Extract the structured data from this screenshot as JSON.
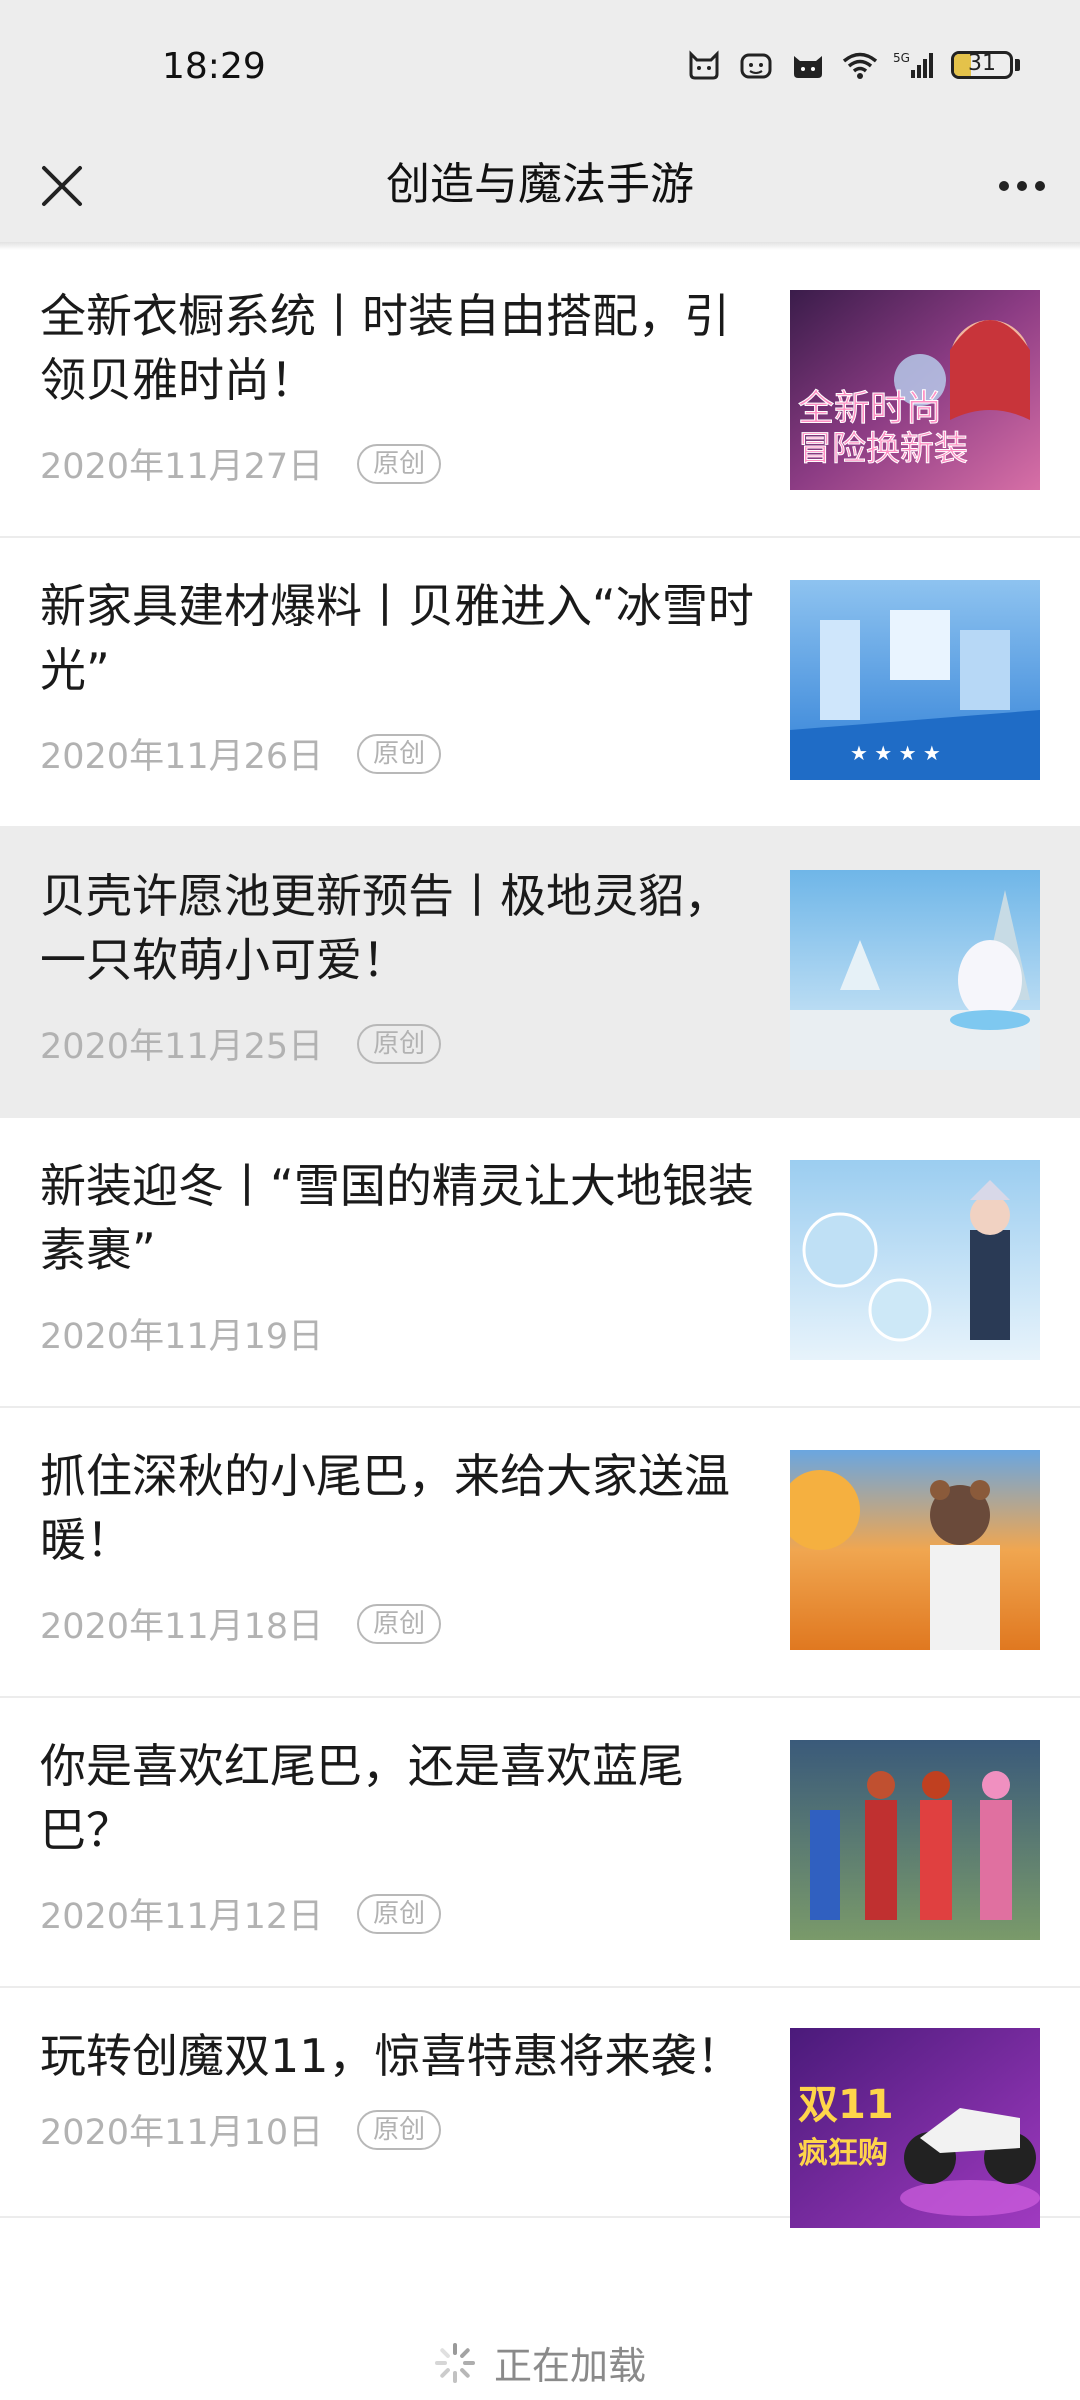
{
  "status_bar": {
    "time": "18:29",
    "battery": "31",
    "battery_level": 0.31,
    "icons": [
      "notification-cat-icon",
      "notification-face-icon",
      "notification-cat2-icon",
      "wifi-icon",
      "signal-5g-icon",
      "battery-icon"
    ]
  },
  "header": {
    "title": "创造与魔法手游",
    "close_icon": "close-icon",
    "more_icon": "more-icon"
  },
  "articles": [
    {
      "title": "全新衣橱系统丨时装自由搭配，引领贝雅时尚！",
      "date": "2020年11月27日",
      "badge": "原创",
      "thumb_text_1": "全新时尚",
      "thumb_text_2": "冒险换新装"
    },
    {
      "title": "新家具建材爆料丨贝雅进入“冰雪时光”",
      "date": "2020年11月26日",
      "badge": "原创"
    },
    {
      "title": "贝壳许愿池更新预告丨极地灵貂，一只软萌小可爱！",
      "date": "2020年11月25日",
      "badge": "原创"
    },
    {
      "title": "新装迎冬丨“雪国的精灵让大地银装素裹”",
      "date": "2020年11月19日"
    },
    {
      "title": "抓住深秋的小尾巴，来给大家送温暖！",
      "date": "2020年11月18日",
      "badge": "原创"
    },
    {
      "title": "你是喜欢红尾巴，还是喜欢蓝尾巴？",
      "date": "2020年11月12日",
      "badge": "原创"
    },
    {
      "title": "玩转创魔双11，惊喜特惠将来袭！",
      "date": "2020年11月10日",
      "badge": "原创",
      "thumb_text_1": "双11",
      "thumb_text_2": "疯狂购"
    }
  ],
  "loading": {
    "text": "正在加载"
  }
}
